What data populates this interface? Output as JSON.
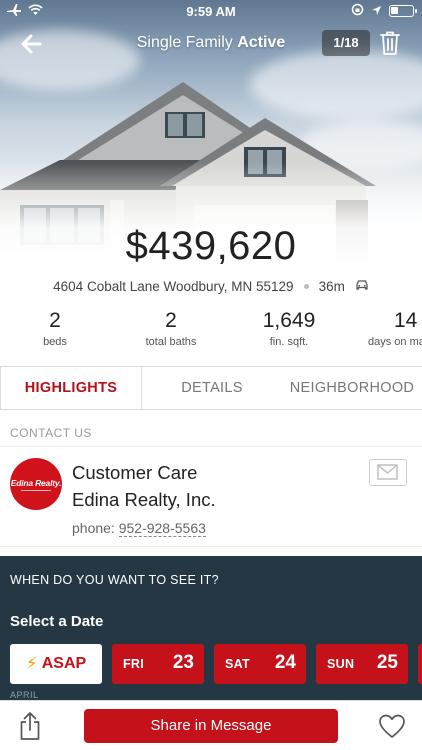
{
  "status_bar": {
    "time": "9:59 AM"
  },
  "nav": {
    "title_type": "Single Family",
    "title_status": "Active",
    "photo_counter": "1/18"
  },
  "listing": {
    "price": "$439,620",
    "address": "4604 Cobalt Lane Woodbury, MN 55129",
    "drive_time": "36m"
  },
  "stats": [
    {
      "value": "2",
      "label": "beds"
    },
    {
      "value": "2",
      "label": "total baths"
    },
    {
      "value": "1,649",
      "label": "fin. sqft."
    },
    {
      "value": "14",
      "label": "days on ma"
    }
  ],
  "tabs": [
    {
      "label": "HIGHLIGHTS",
      "active": true
    },
    {
      "label": "DETAILS",
      "active": false
    },
    {
      "label": "NEIGHBORHOOD",
      "active": false
    }
  ],
  "contact": {
    "heading": "CONTACT US",
    "logo_text": "Edina Realty.",
    "name": "Customer Care",
    "company": "Edina Realty, Inc.",
    "phone_label": "phone:",
    "phone": "952-928-5563"
  },
  "schedule": {
    "question": "WHEN DO YOU WANT TO SEE IT?",
    "title": "Select a Date",
    "asap_label": "ASAP",
    "dates": [
      {
        "dow": "FRI",
        "day": "23"
      },
      {
        "dow": "SAT",
        "day": "24"
      },
      {
        "dow": "SUN",
        "day": "25"
      }
    ],
    "month": "APRIL"
  },
  "bottom_bar": {
    "share_message_label": "Share in Message"
  },
  "colors": {
    "brand_red": "#c4111a",
    "schedule_bg": "#263744",
    "active_tab": "#b3121b"
  }
}
